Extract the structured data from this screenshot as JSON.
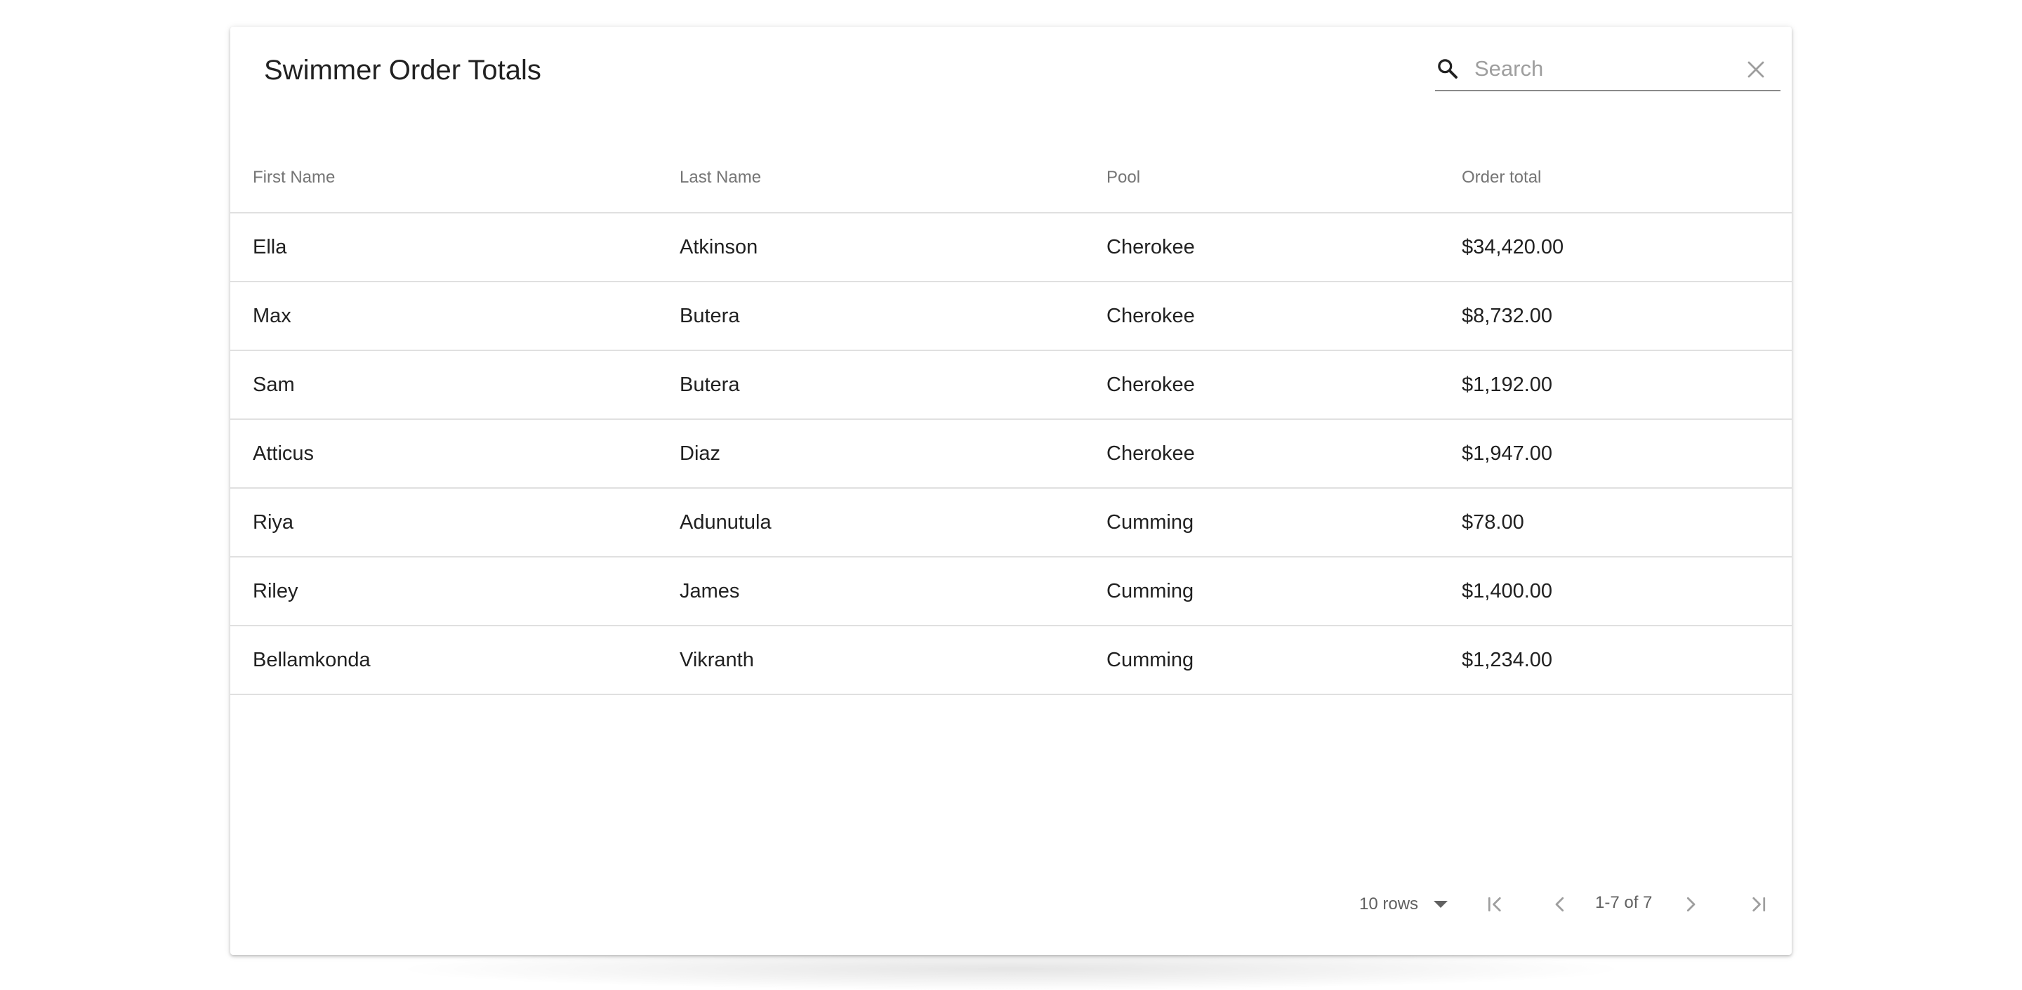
{
  "table": {
    "title": "Swimmer Order Totals",
    "columns": [
      "First Name",
      "Last Name",
      "Pool",
      "Order total"
    ],
    "rows": [
      [
        "Ella",
        "Atkinson",
        "Cherokee",
        "$34,420.00"
      ],
      [
        "Max",
        "Butera",
        "Cherokee",
        "$8,732.00"
      ],
      [
        "Sam",
        "Butera",
        "Cherokee",
        "$1,192.00"
      ],
      [
        "Atticus",
        "Diaz",
        "Cherokee",
        "$1,947.00"
      ],
      [
        "Riya",
        "Adunutula",
        "Cumming",
        "$78.00"
      ],
      [
        "Riley",
        "James",
        "Cumming",
        "$1,400.00"
      ],
      [
        "Bellamkonda",
        "Vikranth",
        "Cumming",
        "$1,234.00"
      ]
    ]
  },
  "search": {
    "placeholder": "Search",
    "value": "",
    "icon": "search-icon",
    "clear_icon": "close-icon"
  },
  "pagination": {
    "rows_per_page_label": "10 rows",
    "range_label": "1-7 of 7",
    "icons": [
      "first-page-icon",
      "previous-page-icon",
      "next-page-icon",
      "last-page-icon"
    ]
  },
  "colors": {
    "text": "#212121",
    "muted_text": "#757575",
    "divider": "#e0e0e0",
    "disabled_icon": "#9e9e9e"
  }
}
